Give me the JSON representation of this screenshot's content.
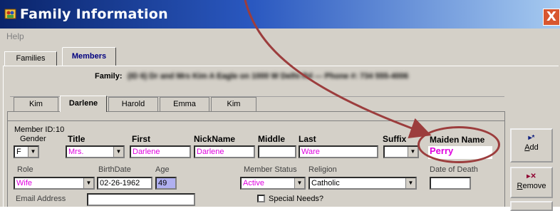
{
  "window": {
    "title": "Family Information",
    "close_symbol": "X"
  },
  "menu": {
    "items": [
      "Help"
    ]
  },
  "outer_tabs": {
    "families": "Families",
    "members": "Members",
    "selected": "Members"
  },
  "family": {
    "label": "Family:",
    "value": "(ID 6) Dr and Mrs Kim A Eagle on 1000 W Delhi Rd --- Phone #: 734 555-4006"
  },
  "member_tabs": {
    "items": [
      "Kim",
      "Darlene",
      "Harold",
      "Emma",
      "Kim"
    ],
    "selected": "Darlene"
  },
  "form": {
    "member_id_label": "Member ID:",
    "member_id": "10",
    "gender_label": "Gender",
    "gender": "F",
    "title_label": "Title",
    "title": "Mrs.",
    "first_label": "First",
    "first": "Darlene",
    "nickname_label": "NickName",
    "nickname": "Darlene",
    "middle_label": "Middle",
    "middle": "",
    "last_label": "Last",
    "last": "Ware",
    "suffix_label": "Suffix",
    "suffix": "",
    "maiden_label": "Maiden Name",
    "maiden": "Perry",
    "role_label": "Role",
    "role": "Wife",
    "birthdate_label": "BirthDate",
    "birthdate": "02-26-1962",
    "age_label": "Age",
    "age": "49",
    "member_status_label": "Member Status",
    "member_status": "Active",
    "religion_label": "Religion",
    "religion": "Catholic",
    "date_of_death_label": "Date of Death",
    "date_of_death": "",
    "email_label": "Email Address",
    "email": "",
    "special_needs_label": "Special Needs?",
    "special_needs_checked": false
  },
  "buttons": {
    "add": {
      "underline": "A",
      "rest": "dd"
    },
    "remove": {
      "underline": "R",
      "rest": "emove"
    }
  },
  "icons": {
    "app": "family-app-icon",
    "add": "add-record-icon",
    "remove": "remove-record-icon",
    "combo_arrow": "chevron-down-icon"
  },
  "colors": {
    "title_bar_start": "#0a246a",
    "title_bar_end": "#a6caf0",
    "field_text": "#e000e0",
    "age_field": "#b0b0f0",
    "annotation": "#9c3d3d",
    "window_bg": "#d4d0c8"
  }
}
